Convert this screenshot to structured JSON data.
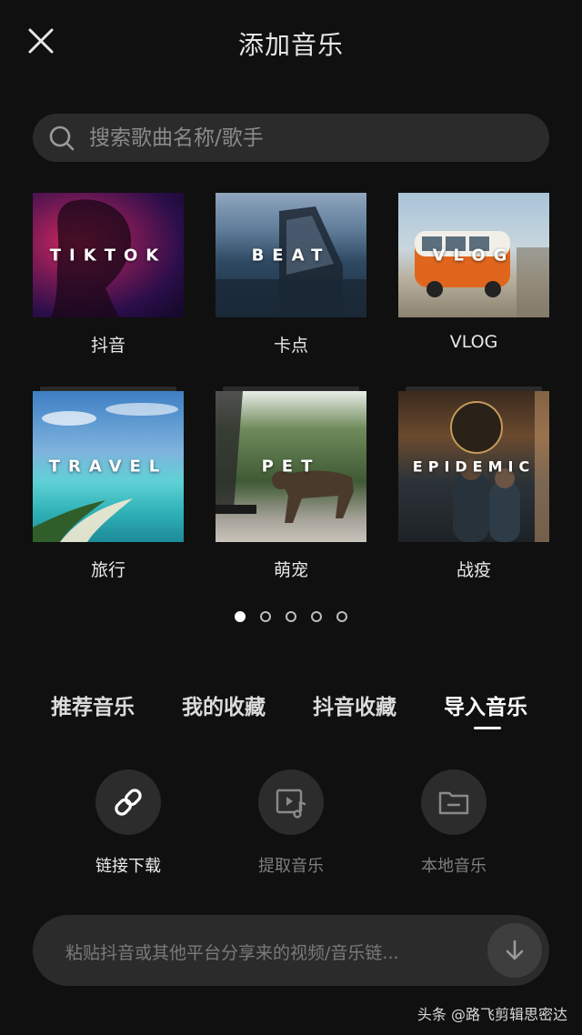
{
  "header": {
    "title": "添加音乐"
  },
  "search": {
    "placeholder": "搜索歌曲名称/歌手"
  },
  "playlists": [
    {
      "cover_text": "TIKTOK",
      "caption": "抖音"
    },
    {
      "cover_text": "BEAT",
      "caption": "卡点"
    },
    {
      "cover_text": "VLOG",
      "caption": "VLOG"
    },
    {
      "cover_text": "TRAVEL",
      "caption": "旅行"
    },
    {
      "cover_text": "PET",
      "caption": "萌宠"
    },
    {
      "cover_text": "EPIDEMIC",
      "caption": "战疫"
    }
  ],
  "pagination": {
    "total": 5,
    "current": 1
  },
  "tabs": [
    {
      "label": "推荐音乐"
    },
    {
      "label": "我的收藏"
    },
    {
      "label": "抖音收藏"
    },
    {
      "label": "导入音乐",
      "active": true
    }
  ],
  "actions": [
    {
      "label": "链接下载",
      "icon": "link-icon"
    },
    {
      "label": "提取音乐",
      "icon": "video-music-icon"
    },
    {
      "label": "本地音乐",
      "icon": "folder-icon"
    }
  ],
  "paste_bar": {
    "placeholder": "粘贴抖音或其他平台分享来的视频/音乐链..."
  },
  "watermark": "头条 @路飞剪辑思密达"
}
